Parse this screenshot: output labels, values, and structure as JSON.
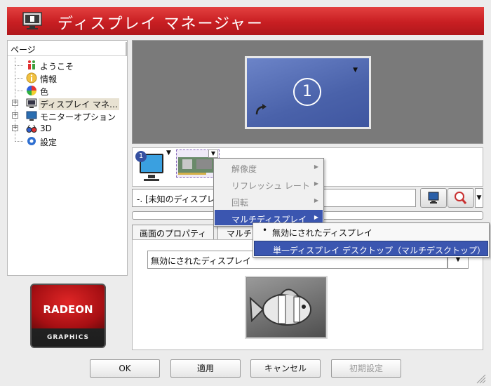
{
  "window": {
    "title": "ディスプレイ マネージャー",
    "accent_color": "#c81e22"
  },
  "tree": {
    "header": "ページ",
    "items": [
      {
        "label": "ようこそ",
        "icon": "welcome-person-icon",
        "expandable": false
      },
      {
        "label": "情報",
        "icon": "info-icon",
        "expandable": false
      },
      {
        "label": "色",
        "icon": "color-wheel-icon",
        "expandable": false
      },
      {
        "label": "ディスプレイ マネ…",
        "icon": "display-manager-icon",
        "expandable": true,
        "selected": true
      },
      {
        "label": "モニターオプション",
        "icon": "monitor-options-icon",
        "expandable": true
      },
      {
        "label": "3D",
        "icon": "3d-glasses-icon",
        "expandable": true
      },
      {
        "label": "設定",
        "icon": "settings-icon",
        "expandable": false
      }
    ]
  },
  "logo": {
    "brand": "RADEON",
    "sub": "GRAPHICS"
  },
  "preview": {
    "display_number": "1"
  },
  "devices": {
    "monitor_badge": "1"
  },
  "combo": {
    "value": "-. [未知のディスプレイ"
  },
  "tabs": [
    {
      "label": "画面のプロパティ"
    },
    {
      "label": "マルチ"
    }
  ],
  "panel": {
    "select_value": "無効にされたディスプレイ"
  },
  "context_menu": {
    "items": [
      {
        "label": "解像度",
        "enabled": false,
        "submenu": true
      },
      {
        "label": "リフレッシュ レート",
        "enabled": false,
        "submenu": true
      },
      {
        "label": "回転",
        "enabled": false,
        "submenu": true
      },
      {
        "label": "マルチディスプレイ",
        "enabled": true,
        "submenu": true,
        "highlighted": true
      }
    ]
  },
  "submenu": {
    "items": [
      {
        "label": "無効にされたディスプレイ",
        "checked": true
      },
      {
        "label": "単一ディスプレイ デスクトップ（マルチデスクトップ）",
        "highlighted": true
      }
    ]
  },
  "buttons": {
    "ok": "OK",
    "apply": "適用",
    "cancel": "キャンセル",
    "reset": "初期設定"
  }
}
